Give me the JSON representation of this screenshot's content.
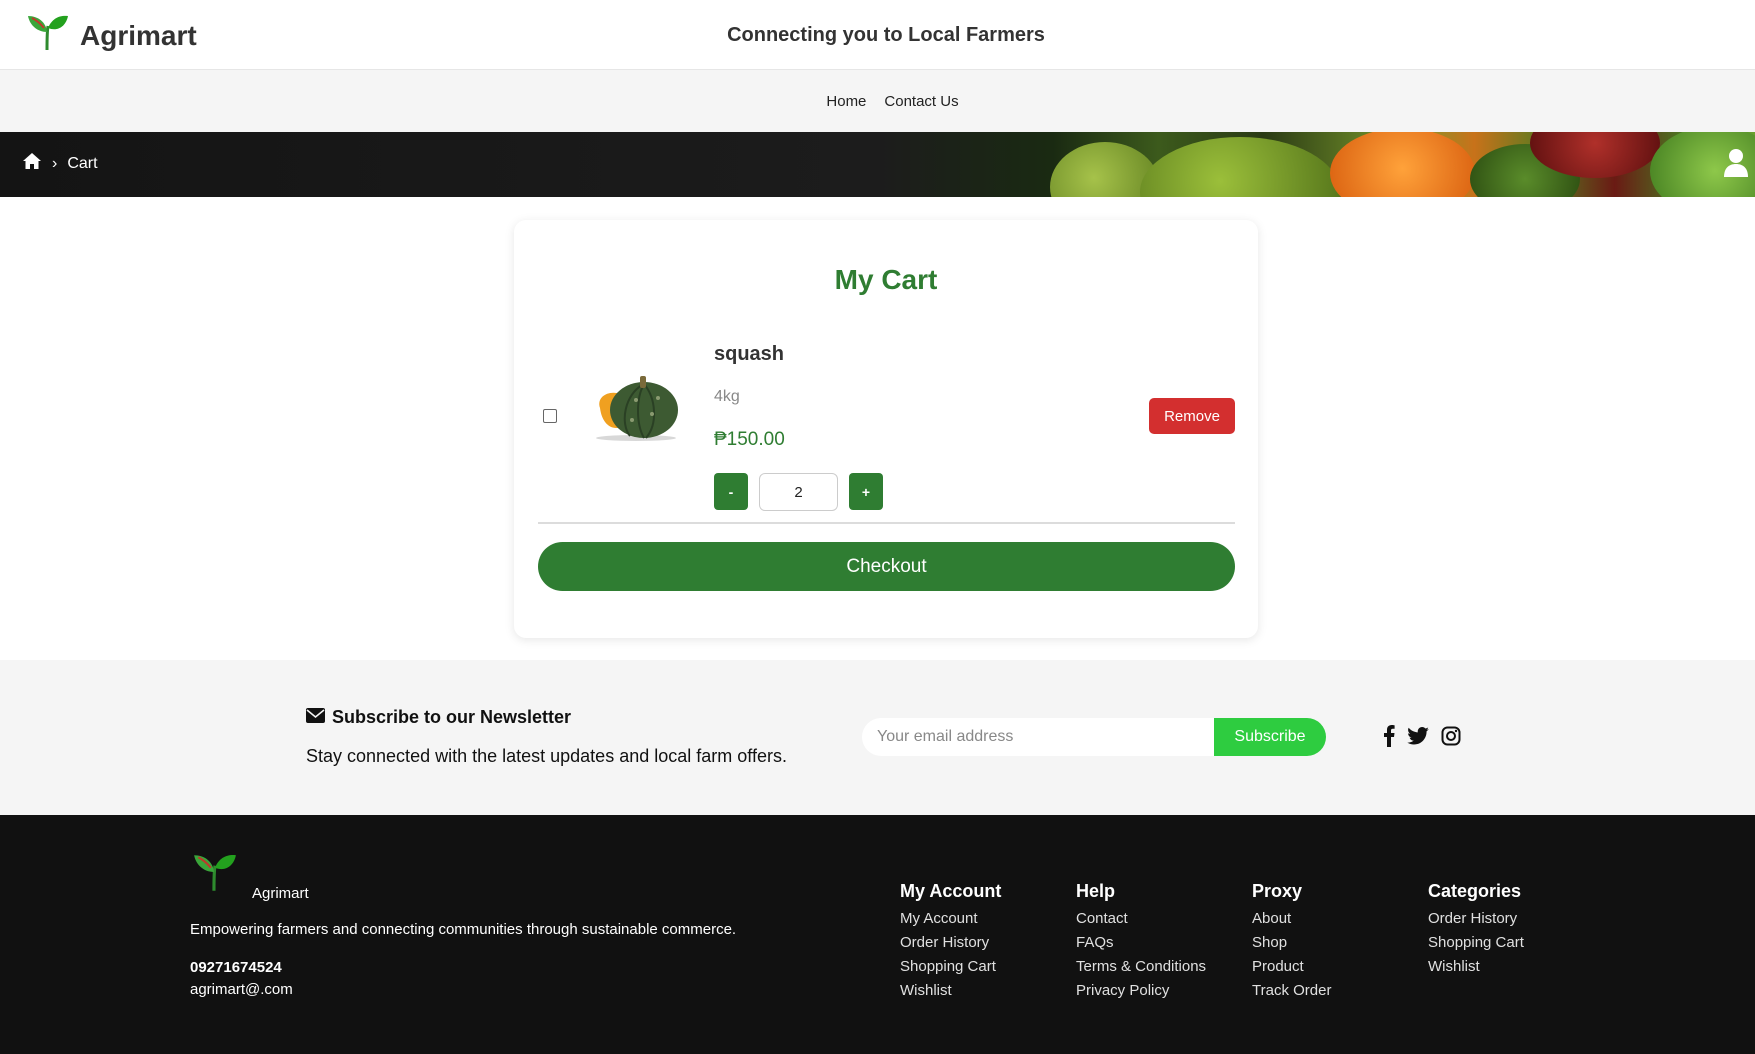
{
  "header": {
    "brand": "Agrimart",
    "tagline": "Connecting you to Local Farmers"
  },
  "nav": {
    "items": [
      {
        "label": "Home"
      },
      {
        "label": "Contact Us"
      }
    ]
  },
  "breadcrumb": {
    "home_icon": "home-icon",
    "separator": "›",
    "current": "Cart"
  },
  "cart": {
    "title": "My Cart",
    "item": {
      "name": "squash",
      "weight": "4kg",
      "price": "₱150.00",
      "quantity": "2",
      "decrement_label": "-",
      "increment_label": "+",
      "remove_label": "Remove",
      "selected": false
    },
    "checkout_label": "Checkout"
  },
  "newsletter": {
    "title": "Subscribe to our Newsletter",
    "subtitle": "Stay connected with the latest updates and local farm offers.",
    "email_placeholder": "Your email address",
    "subscribe_label": "Subscribe",
    "social_icons": [
      "facebook-icon",
      "twitter-icon",
      "instagram-icon"
    ]
  },
  "footer": {
    "brand": "Agrimart",
    "description": "Empowering farmers and connecting communities through sustainable commerce.",
    "phone": "09271674524",
    "email": "agrimart@.com",
    "columns": [
      {
        "title": "My Account",
        "links": [
          "My Account",
          "Order History",
          "Shopping Cart",
          "Wishlist"
        ]
      },
      {
        "title": "Help",
        "links": [
          "Contact",
          "FAQs",
          "Terms & Conditions",
          "Privacy Policy"
        ]
      },
      {
        "title": "Proxy",
        "links": [
          "About",
          "Shop",
          "Product",
          "Track Order"
        ]
      },
      {
        "title": "Categories",
        "links": [
          "Order History",
          "Shopping Cart",
          "Wishlist"
        ]
      }
    ]
  },
  "colors": {
    "brand_green": "#2f7d32",
    "remove_red": "#d32f2f",
    "subscribe_green": "#2ecc40",
    "footer_bg": "#111111"
  }
}
